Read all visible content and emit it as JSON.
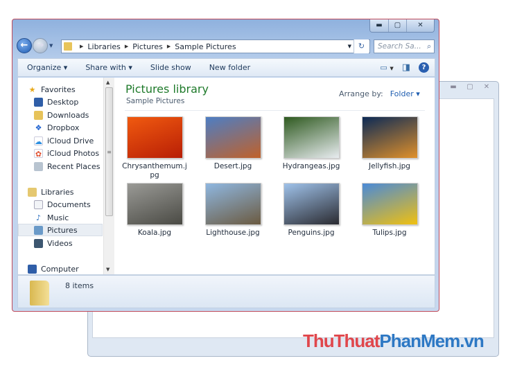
{
  "window": {
    "controls": {
      "minimize": "▬",
      "maximize": "▢",
      "close": "✕"
    }
  },
  "address": {
    "crumbs": [
      "Libraries",
      "Pictures",
      "Sample Pictures"
    ],
    "search_placeholder": "Search Sa..."
  },
  "toolbar": {
    "organize": "Organize ▾",
    "share_with": "Share with ▾",
    "slide_show": "Slide show",
    "new_folder": "New folder"
  },
  "nav": {
    "favorites": "Favorites",
    "favorite_items": [
      "Desktop",
      "Downloads",
      "Dropbox",
      "iCloud Drive",
      "iCloud Photos",
      "Recent Places"
    ],
    "libraries": "Libraries",
    "library_items": [
      "Documents",
      "Music",
      "Pictures",
      "Videos"
    ],
    "selected": "Pictures",
    "computer": "Computer"
  },
  "content": {
    "title": "Pictures library",
    "subtitle": "Sample Pictures",
    "arrange_label": "Arrange by:",
    "arrange_value": "Folder ▾",
    "files": [
      {
        "name": "Chrysanthemum.jpg",
        "colors": [
          "#f05a10",
          "#b81e05"
        ]
      },
      {
        "name": "Desert.jpg",
        "colors": [
          "#4d7ec4",
          "#c0612a"
        ]
      },
      {
        "name": "Hydrangeas.jpg",
        "colors": [
          "#2f5a20",
          "#e8ecf0"
        ]
      },
      {
        "name": "Jellyfish.jpg",
        "colors": [
          "#0c2a56",
          "#e0902a"
        ]
      },
      {
        "name": "Koala.jpg",
        "colors": [
          "#9a9a96",
          "#4a4a44"
        ]
      },
      {
        "name": "Lighthouse.jpg",
        "colors": [
          "#8fb7e0",
          "#6b5a40"
        ]
      },
      {
        "name": "Penguins.jpg",
        "colors": [
          "#9fc2ea",
          "#2a2a30"
        ]
      },
      {
        "name": "Tulips.jpg",
        "colors": [
          "#4a8ad8",
          "#f0c010"
        ]
      }
    ]
  },
  "status": {
    "count": "8 items"
  },
  "watermark": {
    "part1": "ThuThuat",
    "part2": "PhanMem.vn"
  }
}
